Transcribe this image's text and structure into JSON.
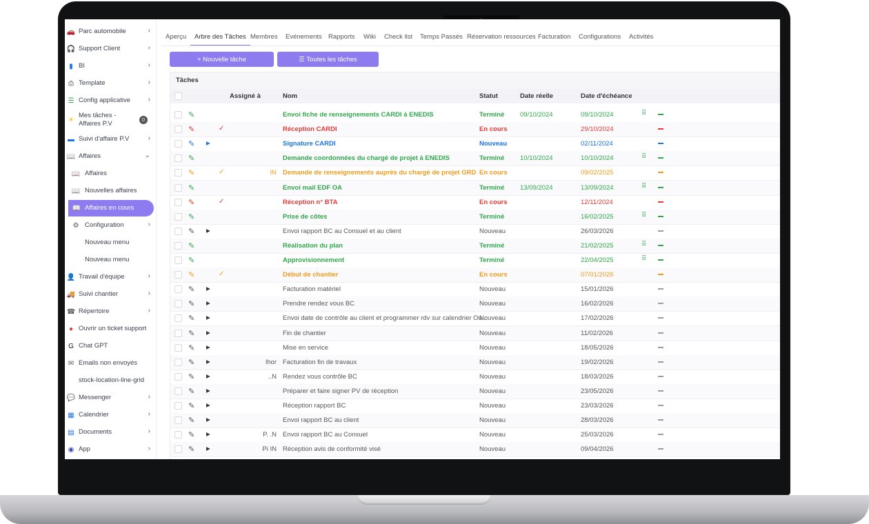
{
  "colors": {
    "accent": "#8c7cf0",
    "green": "#2ea84a",
    "red": "#e53935",
    "blue": "#1a73e8",
    "orange": "#f19a1a",
    "gray": "#555555"
  },
  "sidebar": {
    "items": [
      {
        "label": "Parc automobile",
        "icon": "car-icon",
        "chevron": true
      },
      {
        "label": "Support Client",
        "icon": "support-icon",
        "chevron": true
      },
      {
        "label": "BI",
        "icon": "chart-icon",
        "chevron": true
      },
      {
        "label": "Template",
        "icon": "printer-icon",
        "chevron": true
      },
      {
        "label": "Config applicative",
        "icon": "sliders-icon",
        "chevron": true
      },
      {
        "label": "Mes tâches - Affaires P.V",
        "icon": "sun-icon",
        "badge": "0"
      },
      {
        "label": "Suivi d'affaire P.V",
        "icon": "folder-icon",
        "chevron": true
      },
      {
        "label": "Affaires",
        "icon": "book-icon",
        "chevron": true,
        "expanded": true
      },
      {
        "label": "Affaires",
        "icon": "book-icon",
        "sub": true
      },
      {
        "label": "Nouvelles affaires",
        "icon": "book-icon",
        "sub": true
      },
      {
        "label": "Affaires en cours",
        "icon": "book-icon",
        "sub": true,
        "active": true
      },
      {
        "label": "Configuration",
        "icon": "gear-icon",
        "chevron": true,
        "sub": true
      },
      {
        "label": "Nouveau menu",
        "sub": true
      },
      {
        "label": "Nouveau menu",
        "sub": true
      },
      {
        "label": "Travail d'équipe",
        "icon": "user-icon",
        "chevron": true
      },
      {
        "label": "Suivi chantier",
        "icon": "truck-icon",
        "chevron": true
      },
      {
        "label": "Répertoire",
        "icon": "phone-icon",
        "chevron": true
      },
      {
        "label": "Ouvrir un ticket support",
        "icon": "alert-icon"
      },
      {
        "label": "Chat GPT",
        "icon": "g-logo-icon"
      },
      {
        "label": "Emails non envoyés",
        "icon": "mail-icon"
      },
      {
        "label": "stock-location-line-grid"
      },
      {
        "label": "Messenger",
        "icon": "chat-icon",
        "chevron": true
      },
      {
        "label": "Calendrier",
        "icon": "calendar-icon",
        "chevron": true
      },
      {
        "label": "Documents",
        "icon": "document-icon",
        "chevron": true
      },
      {
        "label": "App",
        "icon": "app-icon",
        "chevron": true
      }
    ]
  },
  "tabs": [
    {
      "label": "Aperçu"
    },
    {
      "label": "Arbre des Tâches",
      "active": true
    },
    {
      "label": "Membres"
    },
    {
      "label": "Evénements"
    },
    {
      "label": "Rapports"
    },
    {
      "label": "Wiki"
    },
    {
      "label": "Check list"
    },
    {
      "label": "Temps Passés"
    },
    {
      "label": "Réservation ressources"
    },
    {
      "label": "Facturation"
    },
    {
      "label": "Configurations"
    },
    {
      "label": "Activités"
    }
  ],
  "toolbar": {
    "new_task": "+ Nouvelle tâche",
    "all_tasks": "☰ Toutes les tâches"
  },
  "table": {
    "title": "Tâches",
    "columns": [
      "Assigné à",
      "Nom",
      "Statut",
      "Date réelle",
      "Date d'échéance"
    ],
    "rows": [
      {
        "assigned": "",
        "name": "Envoi fiche de renseignements CARDI à ENEDIS",
        "status": "Terminé",
        "real": "09/10/2024",
        "due": "09/10/2024",
        "color": "green",
        "tick": false,
        "tri": false,
        "grid": true
      },
      {
        "assigned": "",
        "name": "Réception CARDI",
        "status": "En cours",
        "real": "",
        "due": "29/10/2024",
        "color": "red",
        "tick": true,
        "tri": false,
        "grid": false
      },
      {
        "assigned": "",
        "name": "Signature CARDI",
        "status": "Nouveau",
        "real": "",
        "due": "02/11/2024",
        "color": "blue",
        "tick": false,
        "tri": true,
        "grid": false
      },
      {
        "assigned": "",
        "name": "Demande coordonnées du chargé de projet à ENEDIS",
        "status": "Terminé",
        "real": "10/10/2024",
        "due": "10/10/2024",
        "color": "green",
        "tick": false,
        "tri": false,
        "grid": true
      },
      {
        "assigned": "IN",
        "name": "Demande de renseignements auprès du chargé de projet GRD",
        "status": "En cours",
        "real": "",
        "due": "09/02/2025",
        "color": "orange",
        "tick": true,
        "tri": false,
        "grid": false
      },
      {
        "assigned": "",
        "name": "Envoi mail EDF OA",
        "status": "Terminé",
        "real": "13/09/2024",
        "due": "13/09/2024",
        "color": "green",
        "tick": false,
        "tri": false,
        "grid": true
      },
      {
        "assigned": "",
        "name": "Réception n° BTA",
        "status": "En cours",
        "real": "",
        "due": "12/11/2024",
        "color": "red",
        "tick": true,
        "tri": false,
        "grid": false
      },
      {
        "assigned": "",
        "name": "Prise de côtes",
        "status": "Terminé",
        "real": "",
        "due": "16/02/2025",
        "color": "green",
        "tick": false,
        "tri": false,
        "grid": true
      },
      {
        "assigned": "",
        "name": "Envoi rapport BC au Consuel et au client",
        "status": "Nouveau",
        "real": "",
        "due": "26/03/2026",
        "color": "gray",
        "tick": false,
        "tri": true,
        "grid": false
      },
      {
        "assigned": "",
        "name": "Réalisation du plan",
        "status": "Terminé",
        "real": "",
        "due": "21/02/2025",
        "color": "green",
        "tick": false,
        "tri": false,
        "grid": true
      },
      {
        "assigned": "",
        "name": "Approvisionnement",
        "status": "Terminé",
        "real": "",
        "due": "22/04/2025",
        "color": "green",
        "tick": false,
        "tri": false,
        "grid": true
      },
      {
        "assigned": "",
        "name": "Début de chantier",
        "status": "En cours",
        "real": "",
        "due": "07/01/2026",
        "color": "orange",
        "tick": true,
        "tri": false,
        "grid": false
      },
      {
        "assigned": "",
        "name": "Facturation matériel",
        "status": "Nouveau",
        "real": "",
        "due": "15/01/2026",
        "color": "gray",
        "tick": false,
        "tri": true,
        "grid": false
      },
      {
        "assigned": "",
        "name": "Prendre rendez vous BC",
        "status": "Nouveau",
        "real": "",
        "due": "16/02/2026",
        "color": "gray",
        "tick": false,
        "tri": true,
        "grid": false
      },
      {
        "assigned": "",
        "name": "Envoi date de contrôle au client et programmer rdv sur calendrier Ou...",
        "status": "Nouveau",
        "real": "",
        "due": "17/02/2026",
        "color": "gray",
        "tick": false,
        "tri": true,
        "grid": false
      },
      {
        "assigned": "",
        "name": "Fin de chantier",
        "status": "Nouveau",
        "real": "",
        "due": "11/02/2026",
        "color": "gray",
        "tick": false,
        "tri": true,
        "grid": false
      },
      {
        "assigned": "",
        "name": "Mise en service",
        "status": "Nouveau",
        "real": "",
        "due": "18/05/2026",
        "color": "gray",
        "tick": false,
        "tri": true,
        "grid": false
      },
      {
        "assigned": "lhor",
        "name": "Facturation fin de travaux",
        "status": "Nouveau",
        "real": "",
        "due": "19/02/2026",
        "color": "gray",
        "tick": false,
        "tri": true,
        "grid": false
      },
      {
        "assigned": "..N",
        "name": "Rendez vous contrôle BC",
        "status": "Nouveau",
        "real": "",
        "due": "18/03/2026",
        "color": "gray",
        "tick": false,
        "tri": true,
        "grid": false
      },
      {
        "assigned": "",
        "name": "Préparer et faire signer PV de réception",
        "status": "Nouveau",
        "real": "",
        "due": "23/05/2026",
        "color": "gray",
        "tick": false,
        "tri": true,
        "grid": false
      },
      {
        "assigned": "",
        "name": "Réception rapport BC",
        "status": "Nouveau",
        "real": "",
        "due": "23/03/2026",
        "color": "gray",
        "tick": false,
        "tri": true,
        "grid": false
      },
      {
        "assigned": "",
        "name": "Envoi rapport BC au client",
        "status": "Nouveau",
        "real": "",
        "due": "28/03/2026",
        "color": "gray",
        "tick": false,
        "tri": true,
        "grid": false
      },
      {
        "assigned": "P.      .N",
        "name": "Envoi rapport BC au Consuel",
        "status": "Nouveau",
        "real": "",
        "due": "25/03/2026",
        "color": "gray",
        "tick": false,
        "tri": true,
        "grid": false
      },
      {
        "assigned": "Pi      IN",
        "name": "Réception avis de conformité visé",
        "status": "Nouveau",
        "real": "",
        "due": "09/04/2026",
        "color": "gray",
        "tick": false,
        "tri": true,
        "grid": false
      }
    ]
  }
}
